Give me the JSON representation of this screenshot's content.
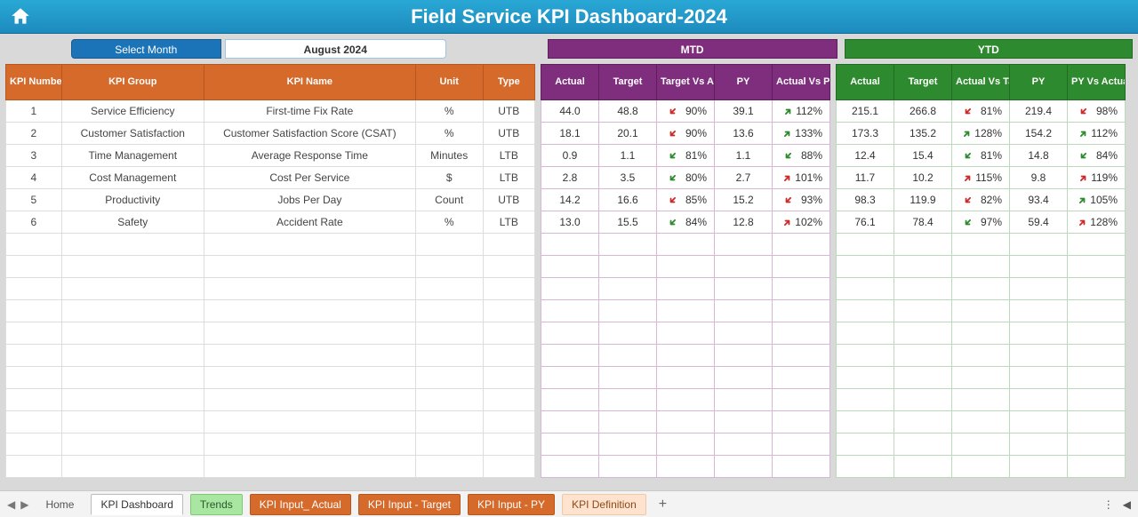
{
  "title": "Field Service KPI Dashboard-2024",
  "selectMonthLabel": "Select Month",
  "selectedMonth": "August 2024",
  "mtdLabel": "MTD",
  "ytdLabel": "YTD",
  "kpiHeaders": {
    "number": "KPI Number",
    "group": "KPI Group",
    "name": "KPI Name",
    "unit": "Unit",
    "type": "Type"
  },
  "mtdHeaders": {
    "actual": "Actual",
    "target": "Target",
    "tva": "Target Vs Actual",
    "py": "PY",
    "avp": "Actual Vs PY"
  },
  "ytdHeaders": {
    "actual": "Actual",
    "target": "Target",
    "avt": "Actual Vs Target",
    "py": "PY",
    "pva": "PY Vs Actual"
  },
  "rows": [
    {
      "num": "1",
      "group": "Service Efficiency",
      "name": "First-time Fix Rate",
      "unit": "%",
      "type": "UTB",
      "mtd": {
        "actual": "44.0",
        "target": "48.8",
        "tva_dir": "down-red",
        "tva": "90%",
        "py": "39.1",
        "avp_dir": "up-green",
        "avp": "112%"
      },
      "ytd": {
        "actual": "215.1",
        "target": "266.8",
        "avt_dir": "down-red",
        "avt": "81%",
        "py": "219.4",
        "pva_dir": "down-red",
        "pva": "98%"
      }
    },
    {
      "num": "2",
      "group": "Customer Satisfaction",
      "name": "Customer Satisfaction Score (CSAT)",
      "unit": "%",
      "type": "UTB",
      "mtd": {
        "actual": "18.1",
        "target": "20.1",
        "tva_dir": "down-red",
        "tva": "90%",
        "py": "13.6",
        "avp_dir": "up-green",
        "avp": "133%"
      },
      "ytd": {
        "actual": "173.3",
        "target": "135.2",
        "avt_dir": "up-green",
        "avt": "128%",
        "py": "154.2",
        "pva_dir": "up-green",
        "pva": "112%"
      }
    },
    {
      "num": "3",
      "group": "Time Management",
      "name": "Average Response Time",
      "unit": "Minutes",
      "type": "LTB",
      "mtd": {
        "actual": "0.9",
        "target": "1.1",
        "tva_dir": "down-green",
        "tva": "81%",
        "py": "1.1",
        "avp_dir": "down-green",
        "avp": "88%"
      },
      "ytd": {
        "actual": "12.4",
        "target": "15.4",
        "avt_dir": "down-green",
        "avt": "81%",
        "py": "14.8",
        "pva_dir": "down-green",
        "pva": "84%"
      }
    },
    {
      "num": "4",
      "group": "Cost Management",
      "name": "Cost Per Service",
      "unit": "$",
      "type": "LTB",
      "mtd": {
        "actual": "2.8",
        "target": "3.5",
        "tva_dir": "down-green",
        "tva": "80%",
        "py": "2.7",
        "avp_dir": "up-red",
        "avp": "101%"
      },
      "ytd": {
        "actual": "11.7",
        "target": "10.2",
        "avt_dir": "up-red",
        "avt": "115%",
        "py": "9.8",
        "pva_dir": "up-red",
        "pva": "119%"
      }
    },
    {
      "num": "5",
      "group": "Productivity",
      "name": "Jobs Per Day",
      "unit": "Count",
      "type": "UTB",
      "mtd": {
        "actual": "14.2",
        "target": "16.6",
        "tva_dir": "down-red",
        "tva": "85%",
        "py": "15.2",
        "avp_dir": "down-red",
        "avp": "93%"
      },
      "ytd": {
        "actual": "98.3",
        "target": "119.9",
        "avt_dir": "down-red",
        "avt": "82%",
        "py": "93.4",
        "pva_dir": "up-green",
        "pva": "105%"
      }
    },
    {
      "num": "6",
      "group": "Safety",
      "name": "Accident Rate",
      "unit": "%",
      "type": "LTB",
      "mtd": {
        "actual": "13.0",
        "target": "15.5",
        "tva_dir": "down-green",
        "tva": "84%",
        "py": "12.8",
        "avp_dir": "up-red",
        "avp": "102%"
      },
      "ytd": {
        "actual": "76.1",
        "target": "78.4",
        "avt_dir": "down-green",
        "avt": "97%",
        "py": "59.4",
        "pva_dir": "up-red",
        "pva": "128%"
      }
    }
  ],
  "emptyRows": 11,
  "tabs": {
    "home": "Home",
    "dashboard": "KPI Dashboard",
    "trends": "Trends",
    "inputActual": "KPI Input_ Actual",
    "inputTarget": "KPI Input - Target",
    "inputPY": "KPI Input - PY",
    "definition": "KPI Definition"
  }
}
